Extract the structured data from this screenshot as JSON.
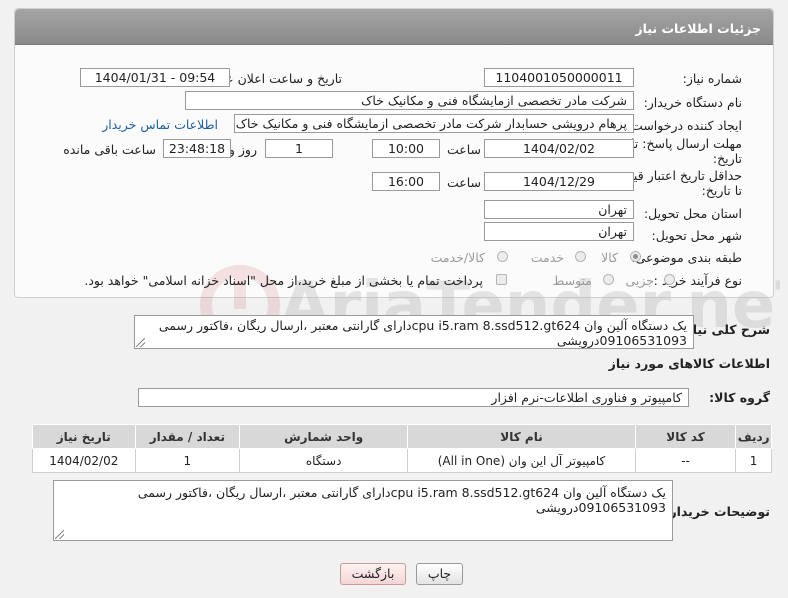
{
  "header": {
    "title": "جزئیات اطلاعات نیاز"
  },
  "form": {
    "need_number_label": "شماره نیاز:",
    "need_number": "1104001050000011",
    "announce_label": "تاریخ و ساعت اعلان عمومی:",
    "announce_value": "1404/01/31 - 09:54",
    "buyer_org_label": "نام دستگاه خریدار:",
    "buyer_org": "شرکت مادر تخصصی ازمایشگاه فنی و مکانیک خاک",
    "creator_label": "ایجاد کننده درخواست:",
    "creator": "پرهام درویشی حسابدار شرکت مادر تخصصی ازمایشگاه فنی و مکانیک خاک",
    "contact_link": "اطلاعات تماس خریدار",
    "deadline_label_1": "مهلت ارسال پاسخ: تا",
    "deadline_label_2": "تاریخ:",
    "deadline_date": "1404/02/02",
    "time_label": "ساعت",
    "deadline_time": "10:00",
    "days_value": "1",
    "days_label": "روز و",
    "remaining_time": "23:48:18",
    "remaining_label": "ساعت باقی مانده",
    "price_validity_label_1": "حداقل تاریخ اعتبار قیمت:",
    "price_validity_label_2": "تا تاریخ:",
    "price_validity_date": "1404/12/29",
    "price_validity_time_label": "ساعت",
    "price_validity_time": "16:00",
    "province_label": "استان محل تحویل:",
    "province": "تهران",
    "city_label": "شهر محل تحویل:",
    "city": "تهران",
    "category_label": "طبقه بندی موضوعی:",
    "category_options": [
      "کالا",
      "خدمت",
      "کالا/خدمت"
    ],
    "category_selected": "کالا",
    "process_label": "نوع فرآیند خرید :",
    "process_options": [
      "جزیی",
      "متوسط"
    ],
    "payment_note": "پرداخت تمام یا بخشی از مبلغ خرید،از محل \"اسناد خزانه اسلامی\" خواهد بود."
  },
  "description": {
    "label": "شرح کلی نیاز:",
    "text": "یک دستگاه آلین وان cpu i5.ram 8.ssd512.gt624دارای گارانتی معتبر ،ارسال ریگان ،فاکتور رسمی 09106531093درویشی"
  },
  "goods_info_title": "اطلاعات کالاهای مورد نیاز",
  "goods_group": {
    "label": "گروه کالا:",
    "value": "کامپیوتر و فناوری اطلاعات-نرم افزار"
  },
  "table": {
    "headers": [
      "ردیف",
      "کد کالا",
      "نام کالا",
      "واحد شمارش",
      "تعداد / مقدار",
      "تاریخ نیاز"
    ],
    "rows": [
      [
        "1",
        "--",
        "کامپیوتر آل این وان (All in One)",
        "دستگاه",
        "1",
        "1404/02/02"
      ]
    ]
  },
  "buyer_notes": {
    "label": "توضیحات خریدار:",
    "text": "یک دستگاه آلین وان  cpu i5.ram 8.ssd512.gt624دارای گارانتی معتبر ،ارسال ریگان ،فاکتور رسمی 09106531093درویشی"
  },
  "buttons": {
    "print": "چاپ",
    "back": "بازگشت"
  },
  "watermark": {
    "text": "AriaTender.neT"
  }
}
